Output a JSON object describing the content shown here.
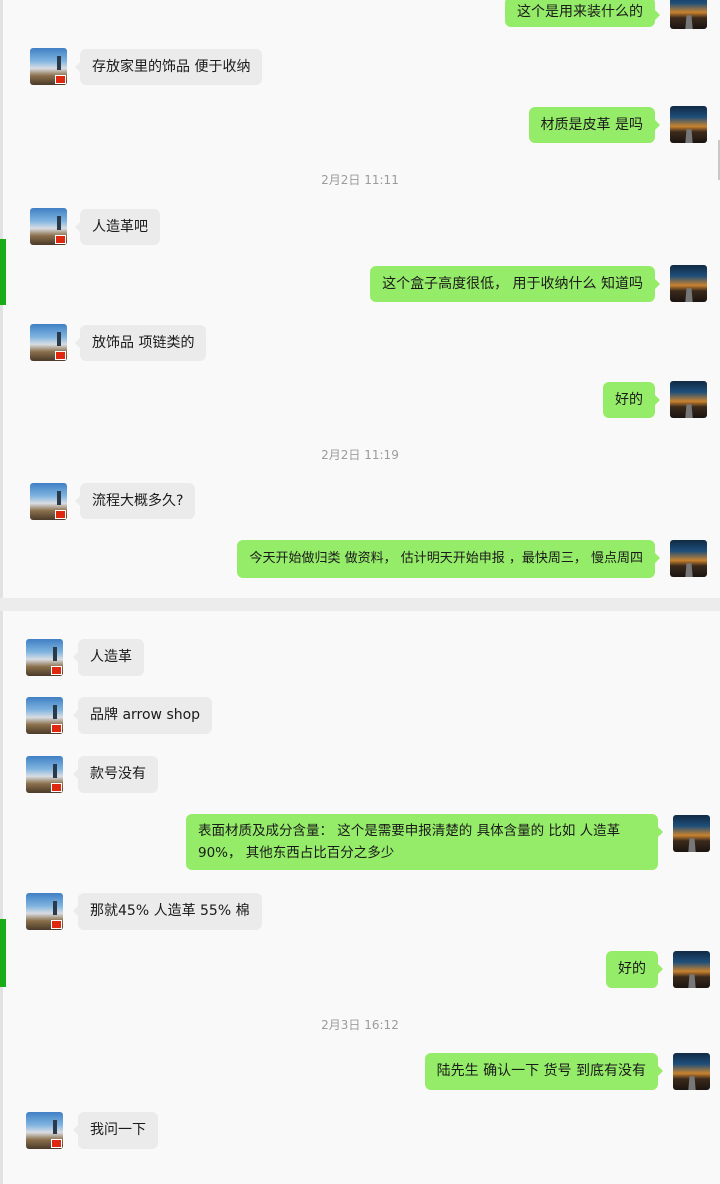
{
  "top_panel": {
    "messages": [
      {
        "side": "out",
        "text": "这个是用来装什么的"
      },
      {
        "side": "in",
        "text": "存放家里的饰品  便于收纳"
      },
      {
        "side": "out",
        "text": "材质是皮革 是吗"
      },
      {
        "side": "time",
        "text": "2月2日 11:11"
      },
      {
        "side": "in",
        "text": "人造革吧"
      },
      {
        "side": "out",
        "text": "这个盒子高度很低， 用于收纳什么 知道吗"
      },
      {
        "side": "in",
        "text": "放饰品 项链类的"
      },
      {
        "side": "out",
        "text": "好的"
      },
      {
        "side": "time",
        "text": "2月2日 11:19"
      },
      {
        "side": "in",
        "text": "流程大概多久?"
      },
      {
        "side": "out",
        "text": "今天开始做归类 做资料， 估计明天开始申报  ，最快周三，  慢点周四"
      }
    ]
  },
  "bottom_panel": {
    "messages": [
      {
        "side": "in",
        "text": "人造革"
      },
      {
        "side": "in",
        "text": "品牌 arrow shop"
      },
      {
        "side": "in",
        "text": "款号没有"
      },
      {
        "side": "out",
        "text": "表面材质及成分含量：   这个是需要申报清楚的 具体含量的  比如  人造革90%，  其他东西占比百分之多少"
      },
      {
        "side": "in",
        "text": "那就45% 人造革 55% 棉"
      },
      {
        "side": "out",
        "text": "好的"
      },
      {
        "side": "time",
        "text": "2月3日 16:12"
      },
      {
        "side": "out",
        "text": "陆先生   确认一下 货号  到底有没有"
      },
      {
        "side": "in",
        "text": "我问一下"
      }
    ]
  }
}
